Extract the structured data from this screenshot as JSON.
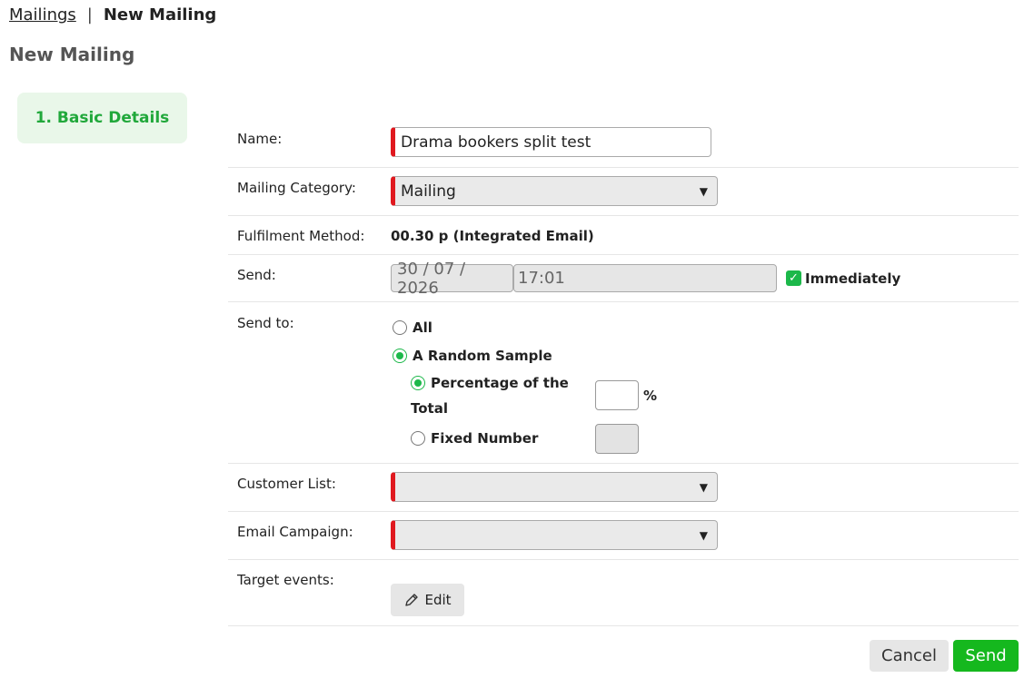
{
  "breadcrumb": {
    "parent": "Mailings",
    "separator": "|",
    "current": "New Mailing"
  },
  "page": {
    "title": "New Mailing"
  },
  "steps": [
    {
      "label": "1. Basic Details"
    }
  ],
  "form": {
    "name": {
      "label": "Name:",
      "value": "Drama bookers split test"
    },
    "category": {
      "label": "Mailing Category:",
      "value": "Mailing"
    },
    "fulfilment": {
      "label": "Fulfilment Method:",
      "value": "00.30 p (Integrated Email)"
    },
    "send": {
      "label": "Send:",
      "date": "30 / 07 / 2026",
      "time": "17:01",
      "immediately_label": "Immediately",
      "immediately_checked": true
    },
    "send_to": {
      "label": "Send to:",
      "all": "All",
      "random": "A Random Sample",
      "percentage": "Percentage of the Total",
      "percentage_line1": "Percentage of the",
      "percentage_line2": "Total",
      "percent_sign": "%",
      "fixed": "Fixed Number",
      "selected": "A Random Sample",
      "sample_mode": "Percentage of the Total"
    },
    "customer_list": {
      "label": "Customer List:",
      "value": ""
    },
    "email_campaign": {
      "label": "Email Campaign:",
      "value": ""
    },
    "target_events": {
      "label": "Target events:",
      "edit_label": "Edit"
    }
  },
  "actions": {
    "cancel": "Cancel",
    "send": "Send"
  },
  "colors": {
    "accent": "#15b81e",
    "required": "#e0191f",
    "step_bg": "#e9f7e9"
  },
  "icons": {
    "edit": "pencil-icon",
    "dropdown": "chevron-down-icon",
    "checkbox": "check-icon"
  }
}
